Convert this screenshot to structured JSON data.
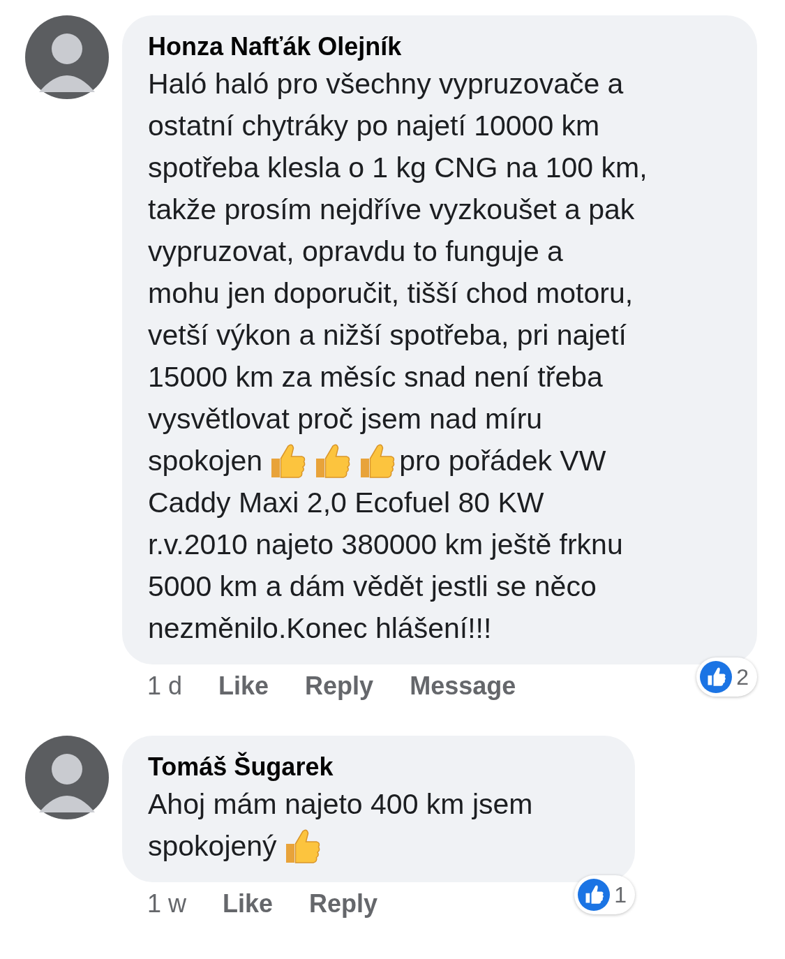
{
  "comments": [
    {
      "author": "Honza Nafťák Olejník",
      "lines": [
        [
          {
            "kind": "text",
            "text": "Haló haló pro všechny vypruzovače a"
          }
        ],
        [
          {
            "kind": "text",
            "text": "ostatní chytráky po najetí 10000 km"
          }
        ],
        [
          {
            "kind": "text",
            "text": "spotřeba klesla o 1 kg CNG na 100 km,"
          }
        ],
        [
          {
            "kind": "text",
            "text": "takže prosím nejdříve vyzkoušet a pak"
          }
        ],
        [
          {
            "kind": "text",
            "text": "vypruzovat, opravdu to funguje a"
          }
        ],
        [
          {
            "kind": "text",
            "text": "mohu jen doporučit, tišší chod motoru,"
          }
        ],
        [
          {
            "kind": "text",
            "text": "vetší výkon a nižší spotřeba, pri najetí"
          }
        ],
        [
          {
            "kind": "text",
            "text": "15000 km za měsíc snad není třeba"
          }
        ],
        [
          {
            "kind": "text",
            "text": "vysvětlovat proč jsem nad míru"
          }
        ],
        [
          {
            "kind": "text",
            "text": "spokojen"
          },
          {
            "kind": "emoji"
          },
          {
            "kind": "emoji"
          },
          {
            "kind": "emoji"
          },
          {
            "kind": "text",
            "text": "pro pořádek VW"
          }
        ],
        [
          {
            "kind": "text",
            "text": "Caddy Maxi 2,0 Ecofuel 80 KW"
          }
        ],
        [
          {
            "kind": "text",
            "text": "r.v.2010 najeto 380000 km ještě frknu"
          }
        ],
        [
          {
            "kind": "text",
            "text": "5000 km a dám vědět jestli se něco"
          }
        ],
        [
          {
            "kind": "text",
            "text": "nezměnilo.Konec hlášení!!!"
          }
        ]
      ],
      "time": "1 d",
      "actions": [
        "Like",
        "Reply",
        "Message"
      ],
      "reactions": "2"
    },
    {
      "author": "Tomáš Šugarek",
      "lines": [
        [
          {
            "kind": "text",
            "text": "Ahoj mám najeto 400 km jsem"
          }
        ],
        [
          {
            "kind": "text",
            "text": "spokojený"
          },
          {
            "kind": "emoji"
          }
        ]
      ],
      "time": "1 w",
      "actions": [
        "Like",
        "Reply"
      ],
      "reactions": "1"
    }
  ]
}
